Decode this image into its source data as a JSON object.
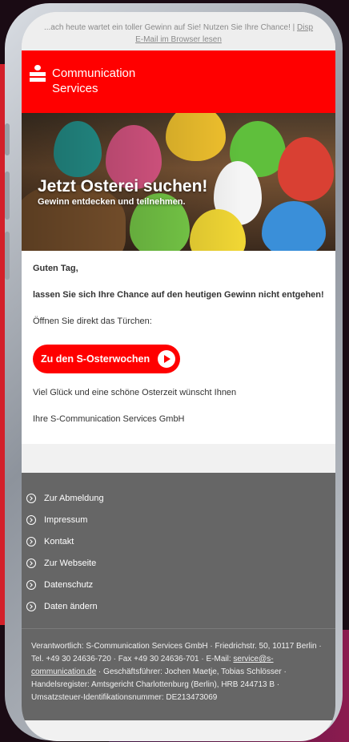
{
  "preheader": {
    "text": "...ach heute wartet ein toller Gewinn auf Sie! Nutzen Sie Ihre Chance! |",
    "link_display": "Disp",
    "link_browser": "E-Mail im Browser lesen"
  },
  "brand": {
    "name_line1": "Communication",
    "name_line2": "Services",
    "color": "#ff0000"
  },
  "hero": {
    "title": "Jetzt Osterei suchen!",
    "subtitle": "Gewinn entdecken und teilnehmen."
  },
  "body": {
    "greeting": "Guten Tag,",
    "headline": "lassen Sie sich Ihre Chance auf den heutigen Gewinn nicht entgehen!",
    "intro": "Öffnen Sie direkt das Türchen:",
    "cta_label": "Zu den S-Osterwochen",
    "closing": "Viel Glück und eine schöne Osterzeit wünscht Ihnen",
    "signature": "Ihre S-Communication Services GmbH"
  },
  "footer": {
    "links": [
      "Zur Abmeldung",
      "Impressum",
      "Kontakt",
      "Zur Webseite",
      "Datenschutz",
      "Daten ändern"
    ],
    "legal_1": "Verantwortlich: S-Communication Services GmbH · Friedrichstr. 50, 10117 Berlin · Tel. +49 30 24636-720 · Fax +49 30 24636-701 · E-Mail: ",
    "email": "service@s-communication.de",
    "legal_2": " · Geschäftsführer: Jochen Maetje, Tobias Schlösser · Handelsregister: Amtsgericht Charlottenburg (Berlin), HRB 244713 B · Umsatzsteuer-Identifikationsnummer: DE213473069"
  }
}
